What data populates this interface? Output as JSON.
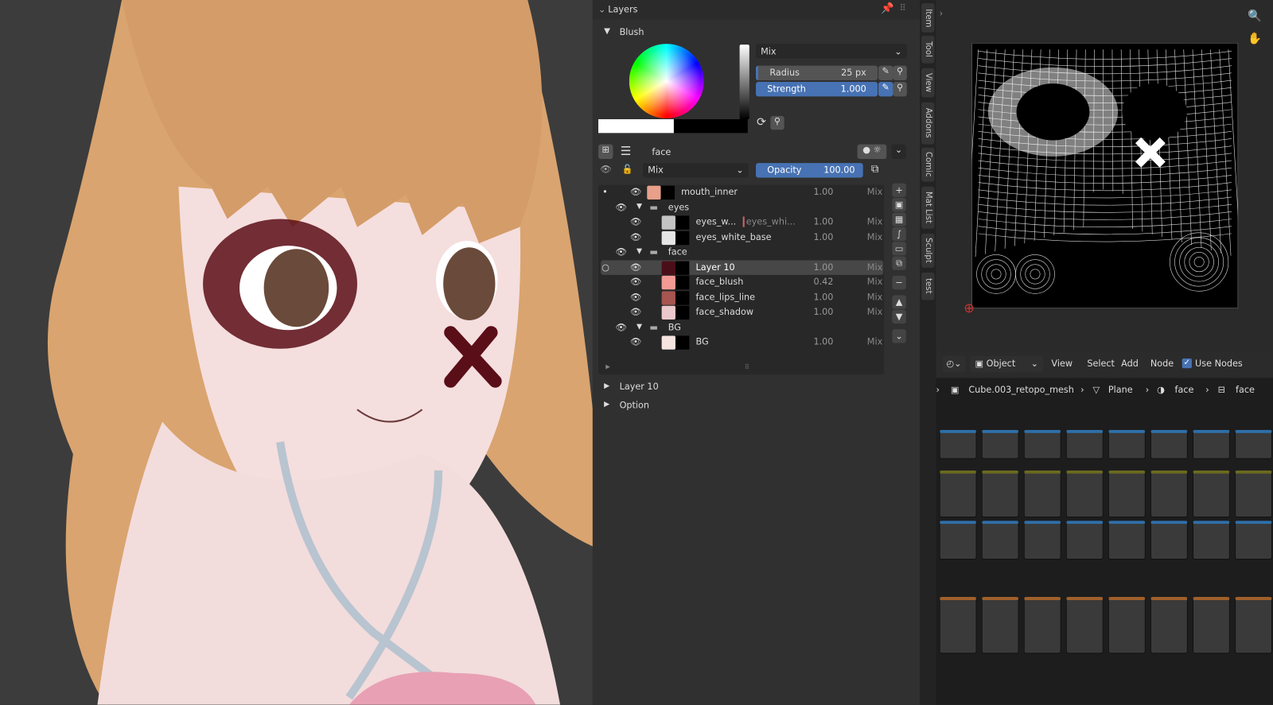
{
  "layers_panel": {
    "title": "Layers",
    "brush_section": "Blush",
    "blend_mode": "Mix",
    "radius_label": "Radius",
    "radius_value": "25 px",
    "strength_label": "Strength",
    "strength_value": "1.000",
    "texture_name": "face",
    "layer_blend": "Mix",
    "opacity_label": "Opacity",
    "opacity_value": "100.00",
    "layers": [
      {
        "name": "mouth_inner",
        "value": "1.00",
        "blend": "Mix",
        "color": "#e8a08a",
        "indent": 0
      },
      {
        "name": "eyes",
        "group": true,
        "indent": 0
      },
      {
        "name": "eyes_w...",
        "extra": "eyes_whi...",
        "value": "1.00",
        "blend": "Mix",
        "color": "#c4c4c4",
        "indent": 1
      },
      {
        "name": "eyes_white_base",
        "value": "1.00",
        "blend": "Mix",
        "color": "#e6e6e6",
        "indent": 1
      },
      {
        "name": "face",
        "group": true,
        "indent": 0
      },
      {
        "name": "Layer 10",
        "value": "1.00",
        "blend": "Mix",
        "color": "#4a0e18",
        "indent": 1,
        "active": true
      },
      {
        "name": "face_blush",
        "value": "0.42",
        "blend": "Mix",
        "color": "#f49a94",
        "indent": 1
      },
      {
        "name": "face_lips_line",
        "value": "1.00",
        "blend": "Mix",
        "color": "#a65550",
        "indent": 1
      },
      {
        "name": "face_shadow",
        "value": "1.00",
        "blend": "Mix",
        "color": "#eac8cc",
        "indent": 1
      },
      {
        "name": "BG",
        "group": true,
        "indent": 0
      },
      {
        "name": "BG",
        "value": "1.00",
        "blend": "Mix",
        "color": "#f6e4e0",
        "indent": 1
      }
    ],
    "sub_panels": [
      "Layer 10",
      "Option"
    ]
  },
  "side_tabs": [
    "Item",
    "Tool",
    "View",
    "Addons",
    "Comic",
    "Mat List",
    "Sculpt",
    "test"
  ],
  "node_editor": {
    "mode": "Object",
    "menu": [
      "View",
      "Select",
      "Add",
      "Node"
    ],
    "use_nodes_label": "Use Nodes",
    "use_nodes": true,
    "breadcrumb": [
      "Cube.003_retopo_mesh",
      "Plane",
      "face",
      "face"
    ]
  },
  "colors": {
    "accent": "#4772b3",
    "panel": "#303030"
  }
}
